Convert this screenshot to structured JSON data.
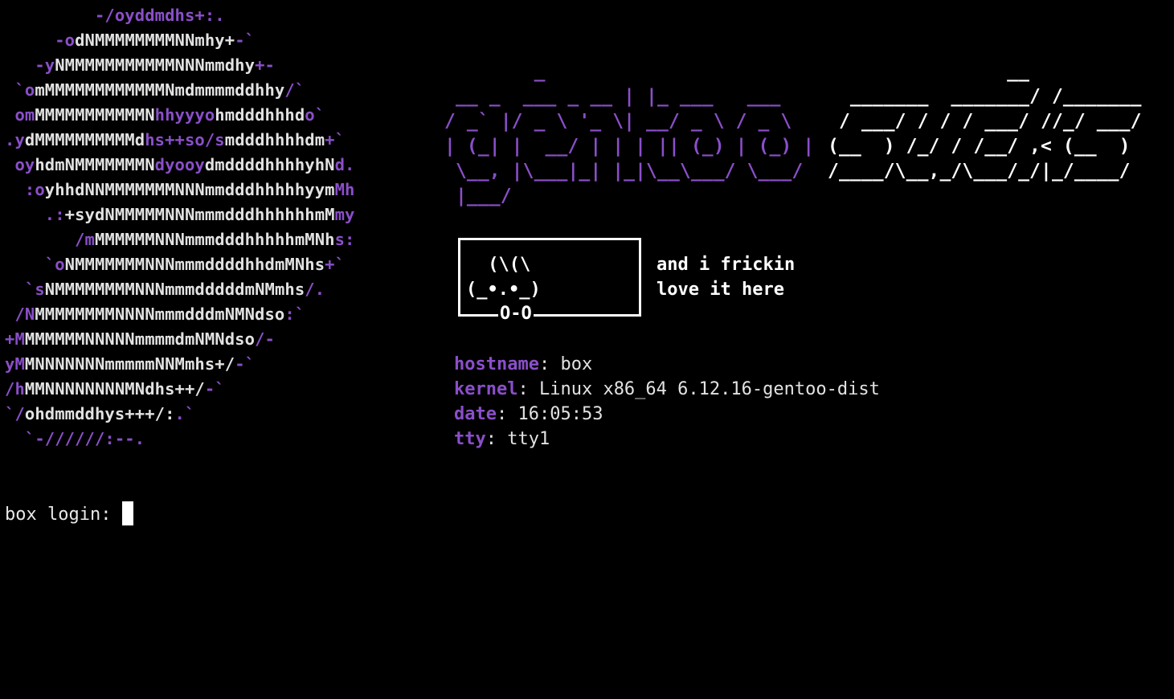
{
  "logo": {
    "lines": [
      [
        [
          "p",
          "         -/oyddmdhs+:."
        ]
      ],
      [
        [
          "p",
          "     -o"
        ],
        [
          "w",
          "dNMMMMMMMMNNmhy+"
        ],
        [
          "p",
          "-`"
        ]
      ],
      [
        [
          "p",
          "   -y"
        ],
        [
          "w",
          "NMMMMMMMMMMMNNNmmdhy"
        ],
        [
          "p",
          "+-"
        ]
      ],
      [
        [
          "p",
          " `o"
        ],
        [
          "w",
          "mMMMMMMMMMMMMNmdmmmmddhhy"
        ],
        [
          "p",
          "/`"
        ]
      ],
      [
        [
          "p",
          " om"
        ],
        [
          "w",
          "MMMMMMMMMMMN"
        ],
        [
          "p",
          "hhyyyo"
        ],
        [
          "w",
          "hmdddhhhd"
        ],
        [
          "p",
          "o`"
        ]
      ],
      [
        [
          "p",
          ".y"
        ],
        [
          "w",
          "dMMMMMMMMMMd"
        ],
        [
          "p",
          "hs++so/s"
        ],
        [
          "w",
          "mdddhhhhdm"
        ],
        [
          "p",
          "+`"
        ]
      ],
      [
        [
          "p",
          " oy"
        ],
        [
          "w",
          "hdmNMMMMMMMN"
        ],
        [
          "p",
          "dyooy"
        ],
        [
          "w",
          "dmddddhhhhyhN"
        ],
        [
          "p",
          "d."
        ]
      ],
      [
        [
          "p",
          "  :o"
        ],
        [
          "w",
          "yhhdNNMMMMMMMNNNmmdddhhhhhyym"
        ],
        [
          "p",
          "Mh"
        ]
      ],
      [
        [
          "p",
          "    .:"
        ],
        [
          "w",
          "+sydNMMMMMNNNmmmdddhhhhhhmM"
        ],
        [
          "p",
          "my"
        ]
      ],
      [
        [
          "p",
          "       /m"
        ],
        [
          "w",
          "MMMMMMNNNmmmdddhhhhhmMNh"
        ],
        [
          "p",
          "s:"
        ]
      ],
      [
        [
          "p",
          "    `o"
        ],
        [
          "w",
          "NMMMMMMMNNNmmmddddhhdmMNhs"
        ],
        [
          "p",
          "+`"
        ]
      ],
      [
        [
          "p",
          "  `s"
        ],
        [
          "w",
          "NMMMMMMMMNNNmmmdddddmNMmhs"
        ],
        [
          "p",
          "/."
        ]
      ],
      [
        [
          "p",
          " /N"
        ],
        [
          "w",
          "MMMMMMMMNNNNmmmdddmNMNdso"
        ],
        [
          "p",
          ":`"
        ]
      ],
      [
        [
          "p",
          "+M"
        ],
        [
          "w",
          "MMMMMMNNNNNmmmmdmNMNdso"
        ],
        [
          "p",
          "/-"
        ]
      ],
      [
        [
          "p",
          "yM"
        ],
        [
          "w",
          "MNNNNNNNmmmmmNNMmhs+/"
        ],
        [
          "p",
          "-`"
        ]
      ],
      [
        [
          "p",
          "/h"
        ],
        [
          "w",
          "MMNNNNNNNNMNdhs++/"
        ],
        [
          "p",
          "-`"
        ]
      ],
      [
        [
          "p",
          "`/"
        ],
        [
          "w",
          "ohdmmddhys+++/:"
        ],
        [
          "p",
          ".`"
        ]
      ],
      [
        [
          "p",
          "  `-//////:--."
        ]
      ]
    ]
  },
  "banner": {
    "gentoo": [
      "        _",
      " __ _  ___ _ __ | |_ ___   ___",
      "/ _` |/ _ \\ '_ \\| __/ _ \\ / _ \\",
      "| (_| |  __/ | | | || (_) | (_) |",
      " \\__, |\\___|_| |_|\\__\\___/ \\___/",
      " |___/"
    ],
    "suck": [
      "                __",
      "  _______  _______/ /_______",
      " / ___/ / / / ___/ //_/ ___/",
      "(__  ) /_/ / /__/ ,< (__  )",
      "/____/\\__,_/\\___/_/|_/____/"
    ]
  },
  "bunny": {
    "ears": " (\\(\\",
    "face": "(_•.•_)",
    "wheels": "O-O",
    "speech_line1": "and i frickin",
    "speech_line2": "love it here"
  },
  "info": {
    "hostname_key": "hostname",
    "hostname_val": ": box",
    "kernel_key": "kernel",
    "kernel_val": ": Linux x86_64 6.12.16-gentoo-dist",
    "date_key": "date",
    "date_val": ": 16:05:53",
    "tty_key": "tty",
    "tty_val": ": tty1"
  },
  "login": {
    "prompt": "box login: "
  },
  "colors": {
    "accent_purple": "#8a4fc9",
    "text": "#e2e2e2",
    "background": "#000000"
  }
}
